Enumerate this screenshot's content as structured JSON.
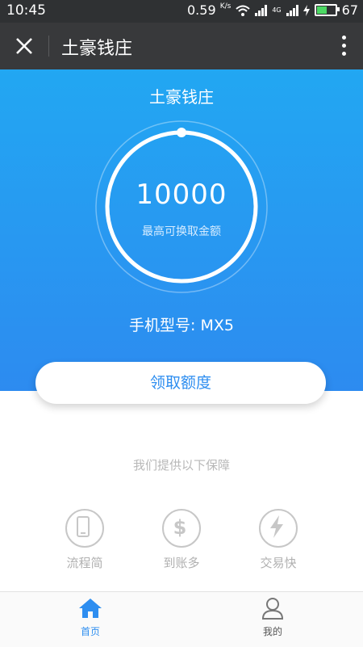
{
  "status_bar": {
    "time": "10:45",
    "network_speed": "0.59",
    "network_speed_unit": "K/s",
    "network_type": "4G",
    "battery_level": "67"
  },
  "app_bar": {
    "title": "土豪钱庄",
    "close_icon": "close-icon",
    "more_icon": "more-vertical-icon"
  },
  "hero": {
    "title": "土豪钱庄",
    "amount": "10000",
    "amount_caption": "最高可换取金额",
    "gauge_progress_fraction": 1.0,
    "phone_model": "手机型号: MX5"
  },
  "claim_button": {
    "label": "领取额度"
  },
  "guarantees": {
    "title": "我们提供以下保障",
    "items": [
      {
        "icon": "phone-icon",
        "label": "流程简"
      },
      {
        "icon": "dollar-icon",
        "label": "到账多"
      },
      {
        "icon": "lightning-icon",
        "label": "交易快"
      }
    ]
  },
  "tab_bar": {
    "items": [
      {
        "icon": "home-icon",
        "label": "首页",
        "active": true
      },
      {
        "icon": "user-icon",
        "label": "我的",
        "active": false
      }
    ]
  },
  "colors": {
    "hero_top": "#22a7f2",
    "hero_bottom": "#2d8bf0",
    "accent": "#2e8ef0",
    "app_bar": "#38393b",
    "status_bar": "#2f3133",
    "muted": "#b0b0b0"
  }
}
